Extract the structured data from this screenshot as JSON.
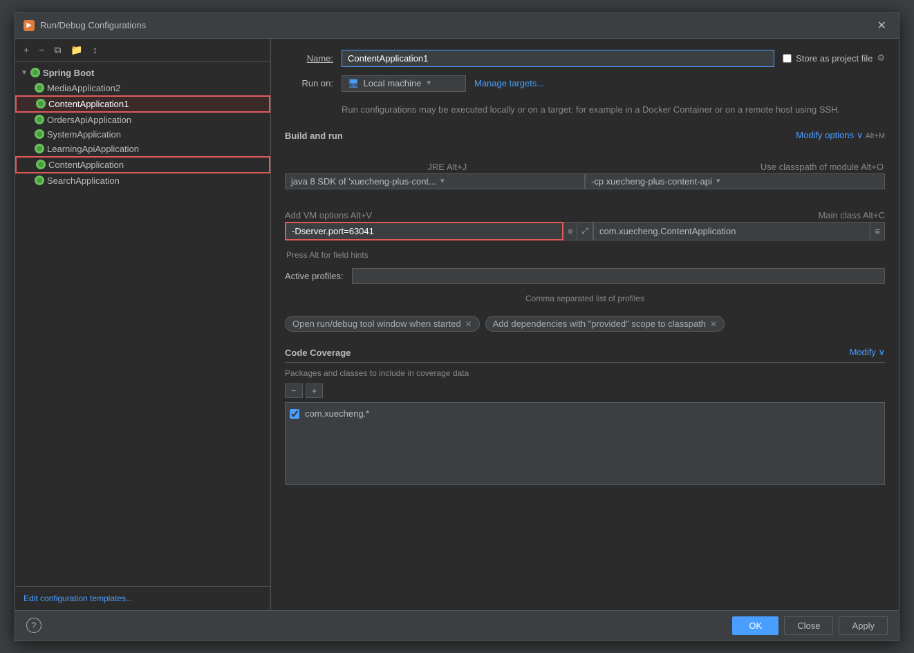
{
  "dialog": {
    "title": "Run/Debug Configurations",
    "close_label": "✕"
  },
  "toolbar": {
    "add_label": "+",
    "remove_label": "−",
    "copy_label": "⧉",
    "folder_label": "📁",
    "sort_label": "↕"
  },
  "tree": {
    "group_label": "Spring Boot",
    "items": [
      {
        "label": "MediaApplication2",
        "selected": false,
        "highlighted": false
      },
      {
        "label": "ContentApplication1",
        "selected": true,
        "highlighted": true
      },
      {
        "label": "OrdersApiApplication",
        "selected": false,
        "highlighted": false
      },
      {
        "label": "SystemApplication",
        "selected": false,
        "highlighted": false
      },
      {
        "label": "LearningApiApplication",
        "selected": false,
        "highlighted": false
      },
      {
        "label": "ContentApplication",
        "selected": false,
        "highlighted": true
      },
      {
        "label": "SearchApplication",
        "selected": false,
        "highlighted": false
      }
    ],
    "edit_config_label": "Edit configuration templates..."
  },
  "form": {
    "name_label": "Name:",
    "name_value": "ContentApplication1",
    "run_on_label": "Run on:",
    "local_machine_label": "Local machine",
    "manage_targets_label": "Manage targets...",
    "run_description": "Run configurations may be executed locally or on a target: for\nexample in a Docker Container or on a remote host using SSH.",
    "store_label": "Store as project file",
    "build_run_title": "Build and run",
    "modify_options_label": "Modify options ∨",
    "modify_options_shortcut": "Alt+M",
    "jre_hint": "JRE Alt+J",
    "sdk_text": "java 8  SDK of 'xuecheng-plus-cont...",
    "add_vm_hint": "Add VM options Alt+V",
    "use_classpath_hint": "Use classpath of module Alt+O",
    "classpath_text": "-cp  xuecheng-plus-content-api",
    "main_class_hint": "Main class Alt+C",
    "vm_options_value": "-Dserver.port=63041",
    "main_class_value": "com.xuecheng.ContentApplication",
    "field_hint": "Press Alt for field hints",
    "active_profiles_label": "Active profiles:",
    "profiles_hint": "Comma separated list of profiles",
    "tag1_label": "Open run/debug tool window when started",
    "tag2_label": "Add dependencies with \"provided\" scope to classpath",
    "code_coverage_title": "Code Coverage",
    "cc_modify_label": "Modify ∨",
    "cc_description": "Packages and classes to include in coverage data",
    "cc_item_label": "com.xuecheng.*"
  },
  "bottom": {
    "ok_label": "OK",
    "close_label": "Close",
    "apply_label": "Apply",
    "help_label": "?"
  }
}
